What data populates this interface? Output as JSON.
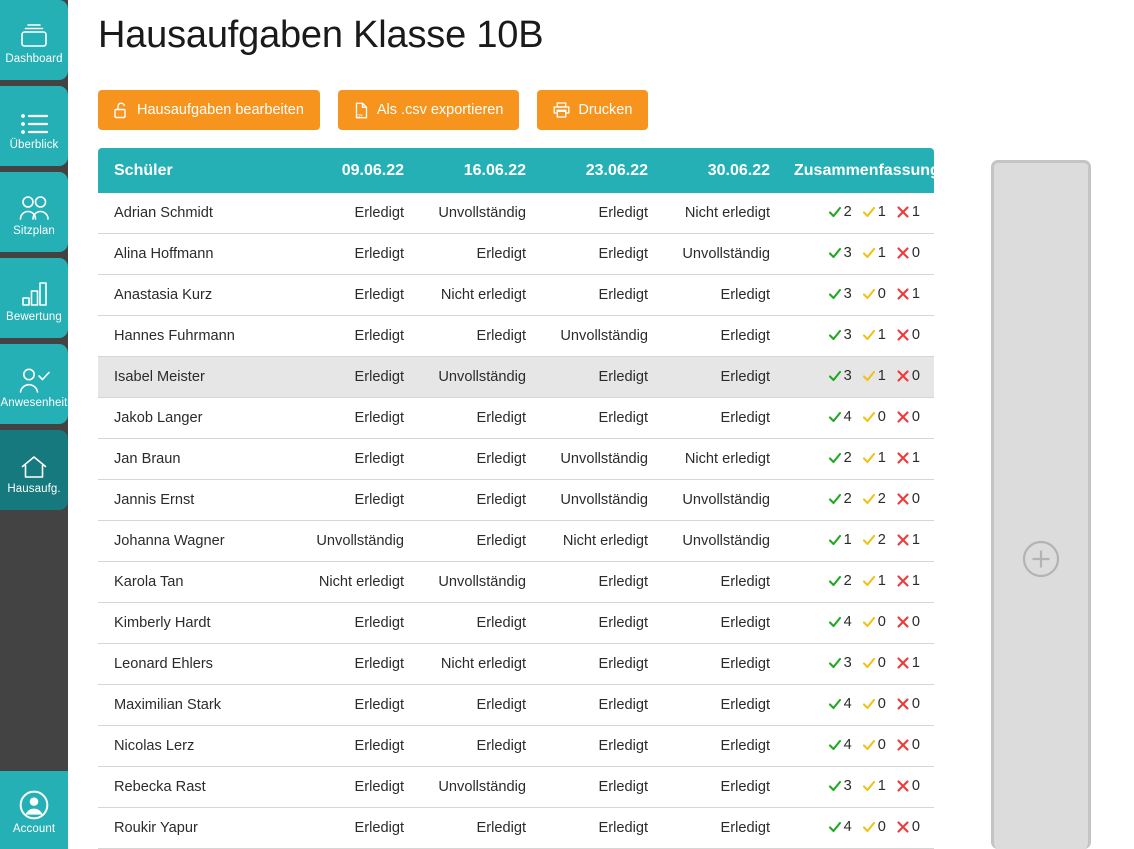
{
  "sidebar": {
    "items": [
      {
        "label": "Dashboard",
        "icon": "dashboard-icon",
        "active": false
      },
      {
        "label": "Überblick",
        "icon": "list-icon",
        "active": false
      },
      {
        "label": "Sitzplan",
        "icon": "users-icon",
        "active": false
      },
      {
        "label": "Bewertung",
        "icon": "bar-chart-icon",
        "active": false
      },
      {
        "label": "Anwesenheit",
        "icon": "user-check-icon",
        "active": false
      },
      {
        "label": "Hausaufg.",
        "icon": "home-icon",
        "active": true
      }
    ],
    "account": {
      "label": "Account",
      "icon": "account-circle-icon"
    }
  },
  "header": {
    "title": "Hausaufgaben Klasse 10B"
  },
  "toolbar": {
    "buttons": [
      {
        "label": "Hausaufgaben bearbeiten",
        "icon": "unlock-icon"
      },
      {
        "label": "Als .csv exportieren",
        "icon": "csv-file-icon"
      },
      {
        "label": "Drucken",
        "icon": "printer-icon"
      }
    ]
  },
  "table": {
    "columns": [
      "Schüler",
      "09.06.22",
      "16.06.22",
      "23.06.22",
      "30.06.22",
      "Zusammenfassung"
    ],
    "rows": [
      {
        "name": "Adrian Schmidt",
        "cells": [
          "Erledigt",
          "Unvollständig",
          "Erledigt",
          "Nicht erledigt"
        ],
        "summary": {
          "done": "2",
          "partial": "1",
          "missing": "1"
        },
        "hovered": false
      },
      {
        "name": "Alina Hoffmann",
        "cells": [
          "Erledigt",
          "Erledigt",
          "Erledigt",
          "Unvollständig"
        ],
        "summary": {
          "done": "3",
          "partial": "1",
          "missing": "0"
        },
        "hovered": false
      },
      {
        "name": "Anastasia Kurz",
        "cells": [
          "Erledigt",
          "Nicht erledigt",
          "Erledigt",
          "Erledigt"
        ],
        "summary": {
          "done": "3",
          "partial": "0",
          "missing": "1"
        },
        "hovered": false
      },
      {
        "name": "Hannes Fuhrmann",
        "cells": [
          "Erledigt",
          "Erledigt",
          "Unvollständig",
          "Erledigt"
        ],
        "summary": {
          "done": "3",
          "partial": "1",
          "missing": "0"
        },
        "hovered": false
      },
      {
        "name": "Isabel Meister",
        "cells": [
          "Erledigt",
          "Unvollständig",
          "Erledigt",
          "Erledigt"
        ],
        "summary": {
          "done": "3",
          "partial": "1",
          "missing": "0"
        },
        "hovered": true
      },
      {
        "name": "Jakob Langer",
        "cells": [
          "Erledigt",
          "Erledigt",
          "Erledigt",
          "Erledigt"
        ],
        "summary": {
          "done": "4",
          "partial": "0",
          "missing": "0"
        },
        "hovered": false
      },
      {
        "name": "Jan Braun",
        "cells": [
          "Erledigt",
          "Erledigt",
          "Unvollständig",
          "Nicht erledigt"
        ],
        "summary": {
          "done": "2",
          "partial": "1",
          "missing": "1"
        },
        "hovered": false
      },
      {
        "name": "Jannis Ernst",
        "cells": [
          "Erledigt",
          "Erledigt",
          "Unvollständig",
          "Unvollständig"
        ],
        "summary": {
          "done": "2",
          "partial": "2",
          "missing": "0"
        },
        "hovered": false
      },
      {
        "name": "Johanna Wagner",
        "cells": [
          "Unvollständig",
          "Erledigt",
          "Nicht erledigt",
          "Unvollständig"
        ],
        "summary": {
          "done": "1",
          "partial": "2",
          "missing": "1"
        },
        "hovered": false
      },
      {
        "name": "Karola Tan",
        "cells": [
          "Nicht erledigt",
          "Unvollständig",
          "Erledigt",
          "Erledigt"
        ],
        "summary": {
          "done": "2",
          "partial": "1",
          "missing": "1"
        },
        "hovered": false
      },
      {
        "name": "Kimberly Hardt",
        "cells": [
          "Erledigt",
          "Erledigt",
          "Erledigt",
          "Erledigt"
        ],
        "summary": {
          "done": "4",
          "partial": "0",
          "missing": "0"
        },
        "hovered": false
      },
      {
        "name": "Leonard Ehlers",
        "cells": [
          "Erledigt",
          "Nicht erledigt",
          "Erledigt",
          "Erledigt"
        ],
        "summary": {
          "done": "3",
          "partial": "0",
          "missing": "1"
        },
        "hovered": false
      },
      {
        "name": "Maximilian Stark",
        "cells": [
          "Erledigt",
          "Erledigt",
          "Erledigt",
          "Erledigt"
        ],
        "summary": {
          "done": "4",
          "partial": "0",
          "missing": "0"
        },
        "hovered": false
      },
      {
        "name": "Nicolas Lerz",
        "cells": [
          "Erledigt",
          "Erledigt",
          "Erledigt",
          "Erledigt"
        ],
        "summary": {
          "done": "4",
          "partial": "0",
          "missing": "0"
        },
        "hovered": false
      },
      {
        "name": "Rebecka Rast",
        "cells": [
          "Erledigt",
          "Unvollständig",
          "Erledigt",
          "Erledigt"
        ],
        "summary": {
          "done": "3",
          "partial": "1",
          "missing": "0"
        },
        "hovered": false
      },
      {
        "name": "Roukir Yapur",
        "cells": [
          "Erledigt",
          "Erledigt",
          "Erledigt",
          "Erledigt"
        ],
        "summary": {
          "done": "4",
          "partial": "0",
          "missing": "0"
        },
        "hovered": false
      }
    ]
  },
  "side_panel": {
    "add_icon": "plus-circle-icon"
  },
  "colors": {
    "teal": "#25b0b5",
    "teal_active": "#16797d",
    "sidebar_bg": "#434343",
    "orange": "#f7941e",
    "done_green": "#21a821",
    "partial_yellow": "#f2c115",
    "missing_red": "#ee3b3b",
    "row_hover": "#e6e6e6"
  }
}
